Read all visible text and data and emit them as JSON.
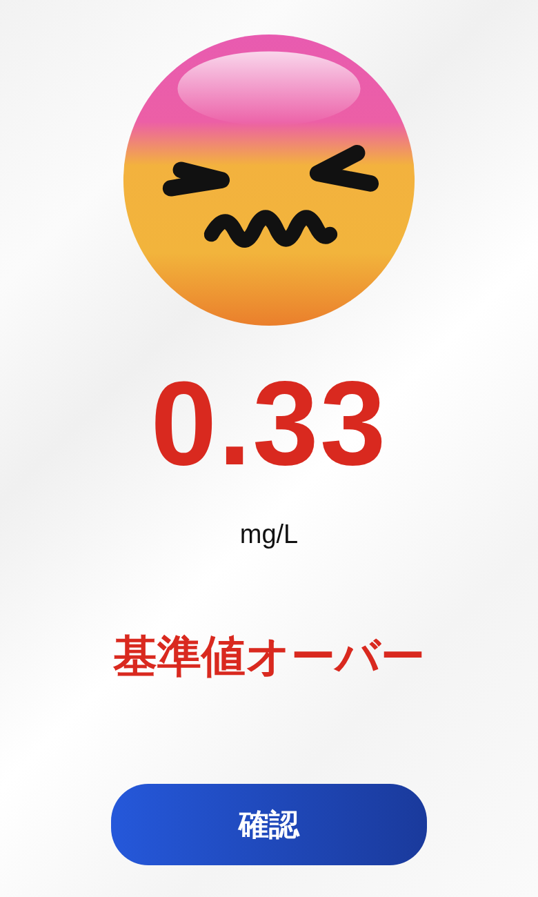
{
  "result": {
    "kind": "over",
    "value": "0.33",
    "unit": "mg/L",
    "status": "基準値オーバー"
  },
  "buttons": [
    {
      "label": "確認"
    }
  ]
}
